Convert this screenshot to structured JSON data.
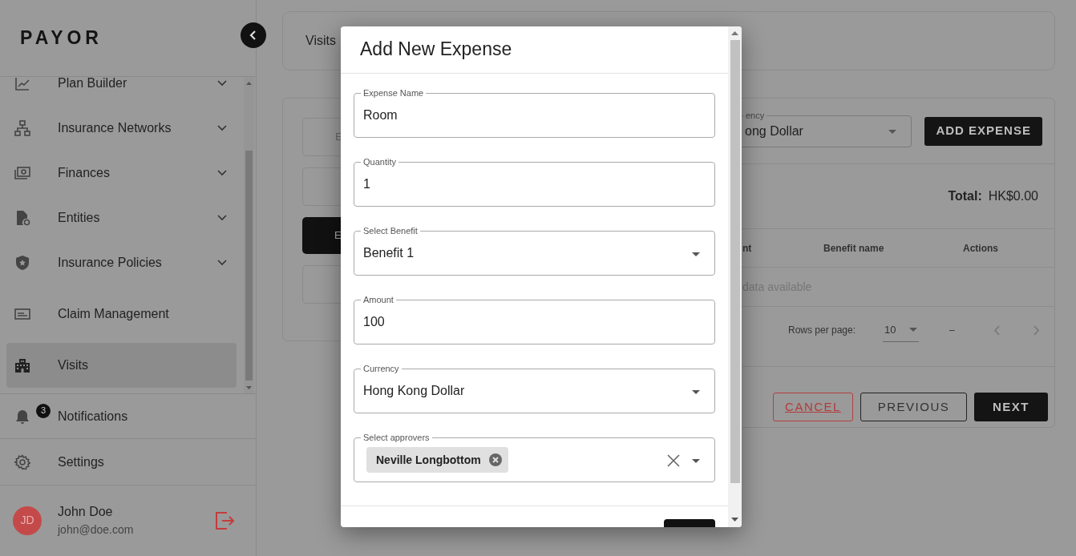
{
  "sidebar": {
    "logo": "PAYOR",
    "nav_items": [
      {
        "label": "Plan Builder",
        "kind": "group",
        "selected": false
      },
      {
        "label": "Insurance Networks",
        "kind": "group",
        "selected": false
      },
      {
        "label": "Finances",
        "kind": "group",
        "selected": false
      },
      {
        "label": "Entities",
        "kind": "group",
        "selected": false
      },
      {
        "label": "Insurance Policies",
        "kind": "group",
        "selected": false
      },
      {
        "label": "Claim Management",
        "kind": "link",
        "selected": false
      },
      {
        "label": "Visits",
        "kind": "link",
        "selected": true
      }
    ],
    "notifications": {
      "label": "Notifications",
      "badge": "3"
    },
    "settings": {
      "label": "Settings"
    },
    "user": {
      "initials": "JD",
      "name": "John Doe",
      "email": "john@doe.com"
    }
  },
  "breadcrumb": {
    "current": "Visits"
  },
  "left_card": {
    "field_text": "E",
    "button_text": "E"
  },
  "expenses_card": {
    "currency_label": "ency",
    "currency_value": "ong Dollar",
    "add_button": "ADD EXPENSE",
    "total_label": "Total:",
    "total_value": "HK$0.00",
    "columns": [
      "nt",
      "Benefit name",
      "Actions"
    ],
    "empty_text": "data available",
    "rows_per_page_label": "Rows per page:",
    "rows_per_page": "10",
    "page_range": "–"
  },
  "footer_buttons": [
    {
      "label": "CANCEL",
      "kind": "cancel"
    },
    {
      "label": "PREVIOUS",
      "kind": "outline"
    },
    {
      "label": "NEXT",
      "kind": "primary"
    }
  ],
  "modal": {
    "title": "Add New Expense",
    "fields": [
      {
        "label": "Expense Name",
        "value": "Room",
        "kind": "text"
      },
      {
        "label": "Quantity",
        "value": "1",
        "kind": "text"
      },
      {
        "label": "Select Benefit",
        "value": "Benefit 1",
        "kind": "select"
      },
      {
        "label": "Amount",
        "value": "100",
        "kind": "text"
      },
      {
        "label": "Currency",
        "value": "Hong Kong Dollar",
        "kind": "select"
      },
      {
        "label": "Select approvers",
        "kind": "multiselect",
        "chips": [
          "Neville Longbottom"
        ]
      }
    ]
  }
}
